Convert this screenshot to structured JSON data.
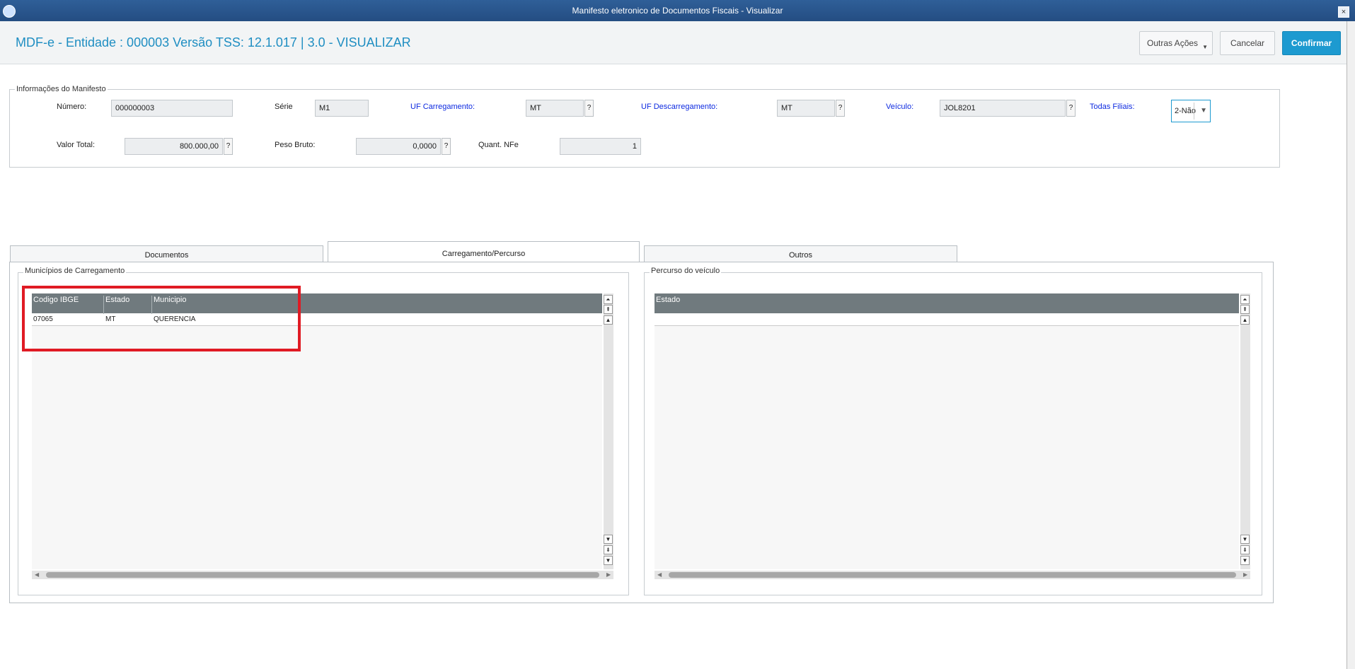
{
  "window": {
    "title": "Manifesto eletronico de Documentos Fiscais - Visualizar",
    "close_glyph": "×"
  },
  "header": {
    "title": "MDF-e - Entidade : 000003 Versão TSS: 12.1.017 | 3.0 - VISUALIZAR",
    "outras_acoes": "Outras Ações",
    "cancelar": "Cancelar",
    "confirmar": "Confirmar"
  },
  "info": {
    "legend": "Informações do Manifesto",
    "numero_label": "Número:",
    "numero_value": "000000003",
    "serie_label": "Série",
    "serie_value": "M1",
    "uf_carreg_label": "UF Carregamento:",
    "uf_carreg_value": "MT",
    "uf_descarreg_label": "UF Descarregamento:",
    "uf_descarreg_value": "MT",
    "veiculo_label": "Veículo:",
    "veiculo_value": "JOL8201",
    "todas_filiais_label": "Todas Filiais:",
    "todas_filiais_value": "2-Não",
    "valor_total_label": "Valor Total:",
    "valor_total_value": "800.000,00",
    "peso_bruto_label": "Peso Bruto:",
    "peso_bruto_value": "0,0000",
    "quant_nfe_label": "Quant. NFe",
    "quant_nfe_value": "1",
    "help_glyph": "?"
  },
  "tabs": [
    "Documentos",
    "Carregamento/Percurso",
    "Outros"
  ],
  "carregamento": {
    "legend": "Municípios de Carregamento",
    "columns": [
      "Codigo IBGE",
      "Estado",
      "Municipio"
    ],
    "rows": [
      {
        "codigo": "07065",
        "estado": "MT",
        "municipio": "QUERENCIA"
      }
    ]
  },
  "percurso": {
    "legend": "Percurso do veículo",
    "columns": [
      "Estado"
    ]
  },
  "icons": {
    "dropdown": "▼",
    "scroll_top": "⏶",
    "scroll_up": "▲",
    "scroll_down": "▼",
    "page_up": "⇞",
    "page_down": "⇟",
    "scroll_left": "◀",
    "scroll_right": "▶"
  },
  "colors": {
    "accent": "#1d9ad0",
    "title_blue": "#1f8ec2",
    "label_blue": "#0d2ae0",
    "grid_header": "#707a7e",
    "highlight": "#e01b24"
  }
}
